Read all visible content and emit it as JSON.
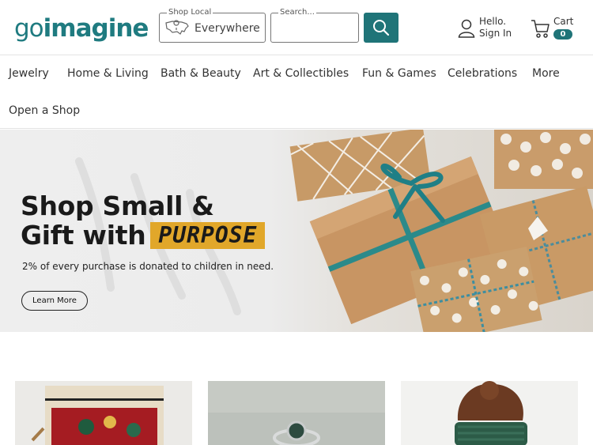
{
  "header": {
    "logo_go": "go",
    "logo_imagine": "imagine",
    "shop_local_legend": "Shop Local",
    "shop_local_value": "Everywhere",
    "search_legend": "Search...",
    "search_value": "",
    "signin_hello": "Hello.",
    "signin_label": "Sign In",
    "cart_label": "Cart",
    "cart_count": "0"
  },
  "nav": {
    "items": [
      "Jewelry",
      "Home & Living",
      "Bath & Beauty",
      "Art & Collectibles",
      "Fun & Games",
      "Celebrations",
      "More",
      "Open a Shop"
    ]
  },
  "hero": {
    "title_line1": "Shop Small &",
    "title_line2": "Gift with",
    "title_highlight": "PURPOSE",
    "subtitle": "2% of every purchase is donated to children in need.",
    "button": "Learn More"
  },
  "colors": {
    "brand": "#1f7478",
    "highlight": "#e1a72a"
  },
  "icons": [
    "usa-map-icon",
    "search-icon",
    "user-icon",
    "cart-icon"
  ]
}
